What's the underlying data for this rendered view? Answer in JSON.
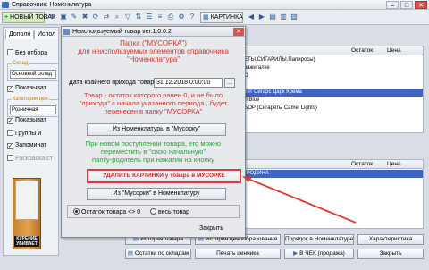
{
  "window": {
    "title": "Справочник: Номенклатура",
    "controls": [
      "–",
      "□",
      "✕"
    ]
  },
  "toolbar": {
    "new_label": "НОВЫЙ ТОВАР",
    "pictures_label": "КАРТИНКА"
  },
  "left": {
    "tabs": [
      "Дополн",
      "Испол"
    ],
    "no_selection": "Без отбора",
    "warehouse_label": "Склад",
    "warehouse_value": "Основной склад",
    "show_label": "Показыват",
    "price_cat_label": "Категория цен",
    "price_cat_value": "Розничная",
    "show2_label": "Показыват",
    "groups_label": "Группы и",
    "remember_label": "Запоминат",
    "color_label": "Раскраска ст"
  },
  "pack": {
    "warning": "КУРЕНИЕ УБИВАЕТ"
  },
  "top_grid": {
    "headers": [
      "Остаток",
      "Цена"
    ],
    "rows": [
      "АРЕТЫ,СИГАРИЛЫ,Папиросы)",
      "на зажигалке",
      "PPO",
      "",
      "Лиггет Сигарс Дарк Крема",
      "Marl Blue",
      "НАБОР (Сигареты Camel Lights)"
    ],
    "selected_row": 4
  },
  "lower_grid": {
    "headers": [
      "Остаток",
      "Цена"
    ],
    "rows": [
      "А78РОДИНА",
      "а80",
      "",
      "",
      "",
      "",
      ""
    ],
    "selected_row": 0
  },
  "dialog": {
    "title": "Неиспользуемый товар ver.1.0.0.2",
    "header_lines": [
      "Папка (\"МУСОРКА\")",
      "для неиспользуемых элементов справочника",
      "\"Номенклатура\""
    ],
    "date_label": "Дата крайнего прихода товара",
    "date_value": "31.12.2018 0:00:00",
    "date_icon": "…",
    "explain_lines": [
      "Товар - остаток которого равен 0, и не было",
      "\"прихода\" с начала указанного периода , будет",
      "перенесен в папку \"МУСОРКА\""
    ],
    "btn_to_trash": "Из Номенклатуры в \"Мусорку\"",
    "new_income_lines": [
      "При новом поступлении товара, его можно",
      "переместить  в  \"свою начальную\"",
      "папку-родитель при нажатии на кнопку"
    ],
    "btn_delete_pictures": "УДАЛИТЬ КАРТИНКИ у товара в МУСОРКЕ",
    "btn_from_trash": "Из \"Мусорки\" в Номенклатуру",
    "radio_stock": "Остаток товара <> 0",
    "radio_all": "весь товар",
    "close_label": "Закрыть"
  },
  "bottom": {
    "row1": [
      "История товара",
      "История ценообразования",
      "Порядок в Номенклатуре",
      "Характеристика"
    ],
    "row2": [
      "Остатки по складам",
      "Печать ценника",
      "В ЧЕК (продажа)",
      "Закрыть"
    ],
    "right_close": "Закрыть"
  }
}
